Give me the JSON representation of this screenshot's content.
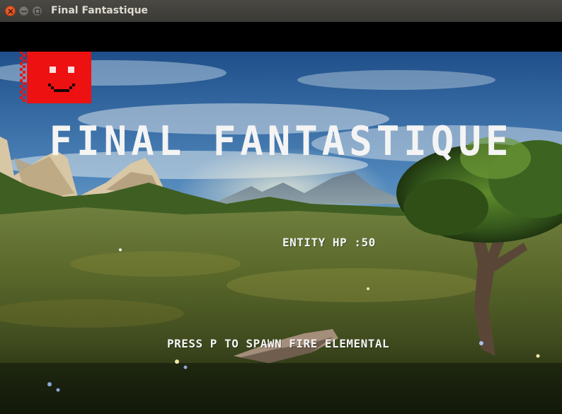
{
  "window": {
    "title": "Final Fantastique",
    "controls": [
      "close-icon",
      "minimize-icon",
      "maximize-icon"
    ]
  },
  "game": {
    "title": "FINAL FANTASTIQUE",
    "entity_hp_label": "ENTITY HP :",
    "entity_hp_value": "50",
    "spawn_prompt": "PRESS P TO SPAWN FIRE ELEMENTAL",
    "player_sprite": "red-smiley-block",
    "colors": {
      "sprite": "#ee1111",
      "text": "#f4f4f4",
      "titlebar": "#3f3e3a",
      "close_button": "#e65a2a"
    }
  }
}
